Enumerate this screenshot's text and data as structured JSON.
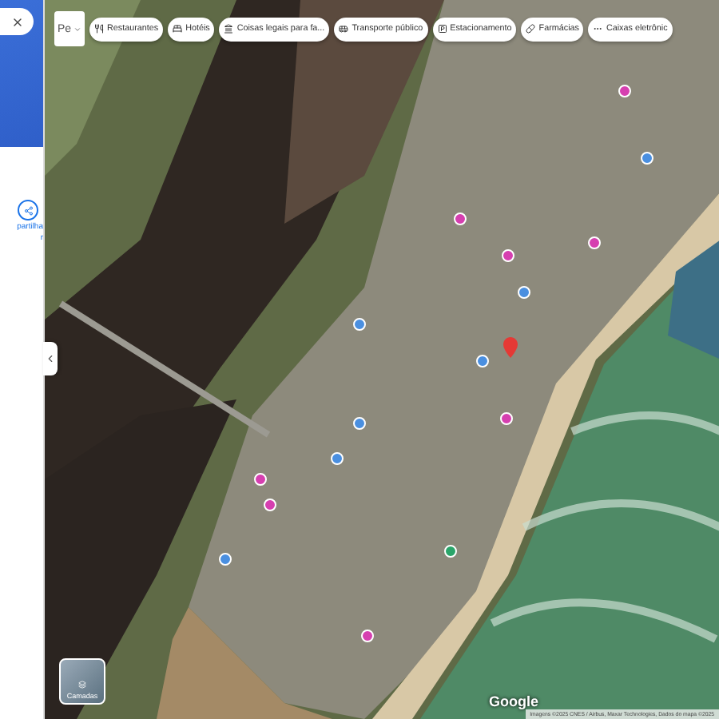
{
  "side_panel": {
    "share_label": "partilha",
    "share_label_2": "r"
  },
  "map": {
    "type_selector": "Pe",
    "chips": [
      {
        "label": "Restaurantes"
      },
      {
        "label": "Hotéis"
      },
      {
        "label": "Coisas legais para fa..."
      },
      {
        "label": "Transporte público"
      },
      {
        "label": "Estacionamento"
      },
      {
        "label": "Farmácias"
      },
      {
        "label": "Caixas eletrônic"
      }
    ],
    "layers_label": "Camadas",
    "logo": "Google",
    "attribution": "Imagens ©2025 CNES / Airbus, Maxar Technologies, Dados do mapa ©2025"
  }
}
